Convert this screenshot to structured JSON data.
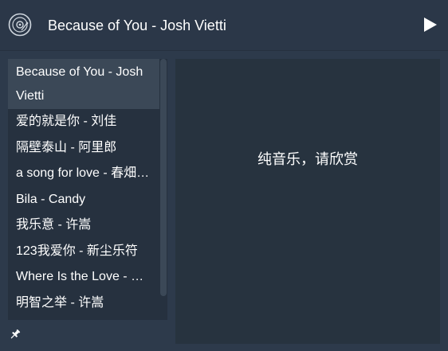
{
  "header": {
    "now_playing": "Because of You - Josh Vietti",
    "icons": {
      "disc": "disc-icon",
      "play": "play-icon"
    }
  },
  "playlist": {
    "items": [
      {
        "label": "Because of You - Josh Vietti",
        "active": true
      },
      {
        "label": "爱的就是你 - 刘佳",
        "active": false
      },
      {
        "label": "隔壁泰山 - 阿里郎",
        "active": false
      },
      {
        "label": "a song for love - 春畑…",
        "active": false
      },
      {
        "label": "Bila - Candy",
        "active": false
      },
      {
        "label": "我乐意 - 许嵩",
        "active": false
      },
      {
        "label": "123我爱你 - 新尘乐符",
        "active": false
      },
      {
        "label": "Where Is the Love - …",
        "active": false
      },
      {
        "label": "明智之举 - 许嵩",
        "active": false
      }
    ]
  },
  "lyrics": {
    "message": "纯音乐，请欣赏"
  },
  "footer": {
    "pin_icon": "pin-icon"
  },
  "colors": {
    "header_bg": "#2b3748",
    "playlist_bg": "#26313f",
    "active_item_bg": "#3b4857",
    "lyrics_bg": "#27333f",
    "text": "#ffffff"
  }
}
